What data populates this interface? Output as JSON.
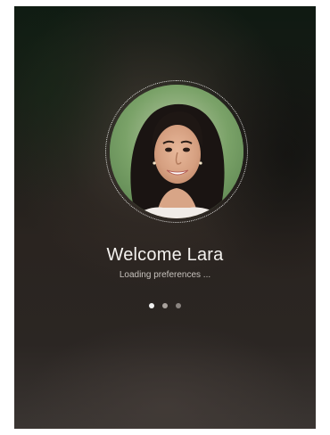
{
  "login": {
    "welcome_text": "Welcome Lara",
    "loading_text": "Loading preferences ...",
    "loading_dots": [
      {
        "state": "active"
      },
      {
        "state": "inactive"
      },
      {
        "state": "inactive"
      }
    ]
  },
  "colors": {
    "text_primary": "#f4f2ef",
    "text_secondary": "#d8d3ce",
    "dot_active": "#f1f1f1",
    "dot_inactive": "#8a8480"
  }
}
